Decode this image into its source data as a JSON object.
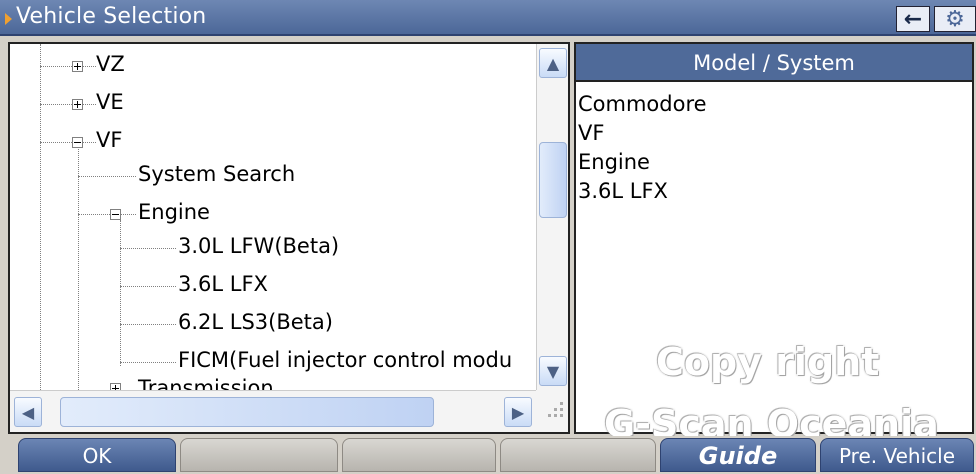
{
  "title": {
    "text": "Vehicle Selection",
    "back_icon": "←",
    "settings_icon": "⚙"
  },
  "tree": {
    "items": [
      {
        "label": "VZ",
        "expander": "+"
      },
      {
        "label": "VE",
        "expander": "+"
      },
      {
        "label": "VF",
        "expander": "-"
      },
      {
        "label": "System Search"
      },
      {
        "label": "Engine",
        "expander": "-"
      },
      {
        "label": "3.0L LFW(Beta)"
      },
      {
        "label": "3.6L LFX"
      },
      {
        "label": "6.2L LS3(Beta)"
      },
      {
        "label": "FICM(Fuel injector control modu"
      },
      {
        "label": "Transmission",
        "expander": "+"
      }
    ],
    "scroll_up": "▲",
    "scroll_down": "▼",
    "scroll_left": "◀",
    "scroll_right": "▶"
  },
  "model_system": {
    "header": "Model / System",
    "items": [
      "Commodore",
      "VF",
      "Engine",
      "3.6L LFX"
    ]
  },
  "watermark": {
    "line1": "Copy right",
    "line2": "G-Scan Oceania"
  },
  "bottom_buttons": {
    "ok": "OK",
    "blank1": "",
    "blank2": "",
    "blank3": "",
    "guide": "Guide",
    "pre_vehicle": "Pre. Vehicle"
  },
  "colors": {
    "title_bar": "#4c6798",
    "button_active": "#3f5a8d",
    "watermark": "#ffffff"
  }
}
